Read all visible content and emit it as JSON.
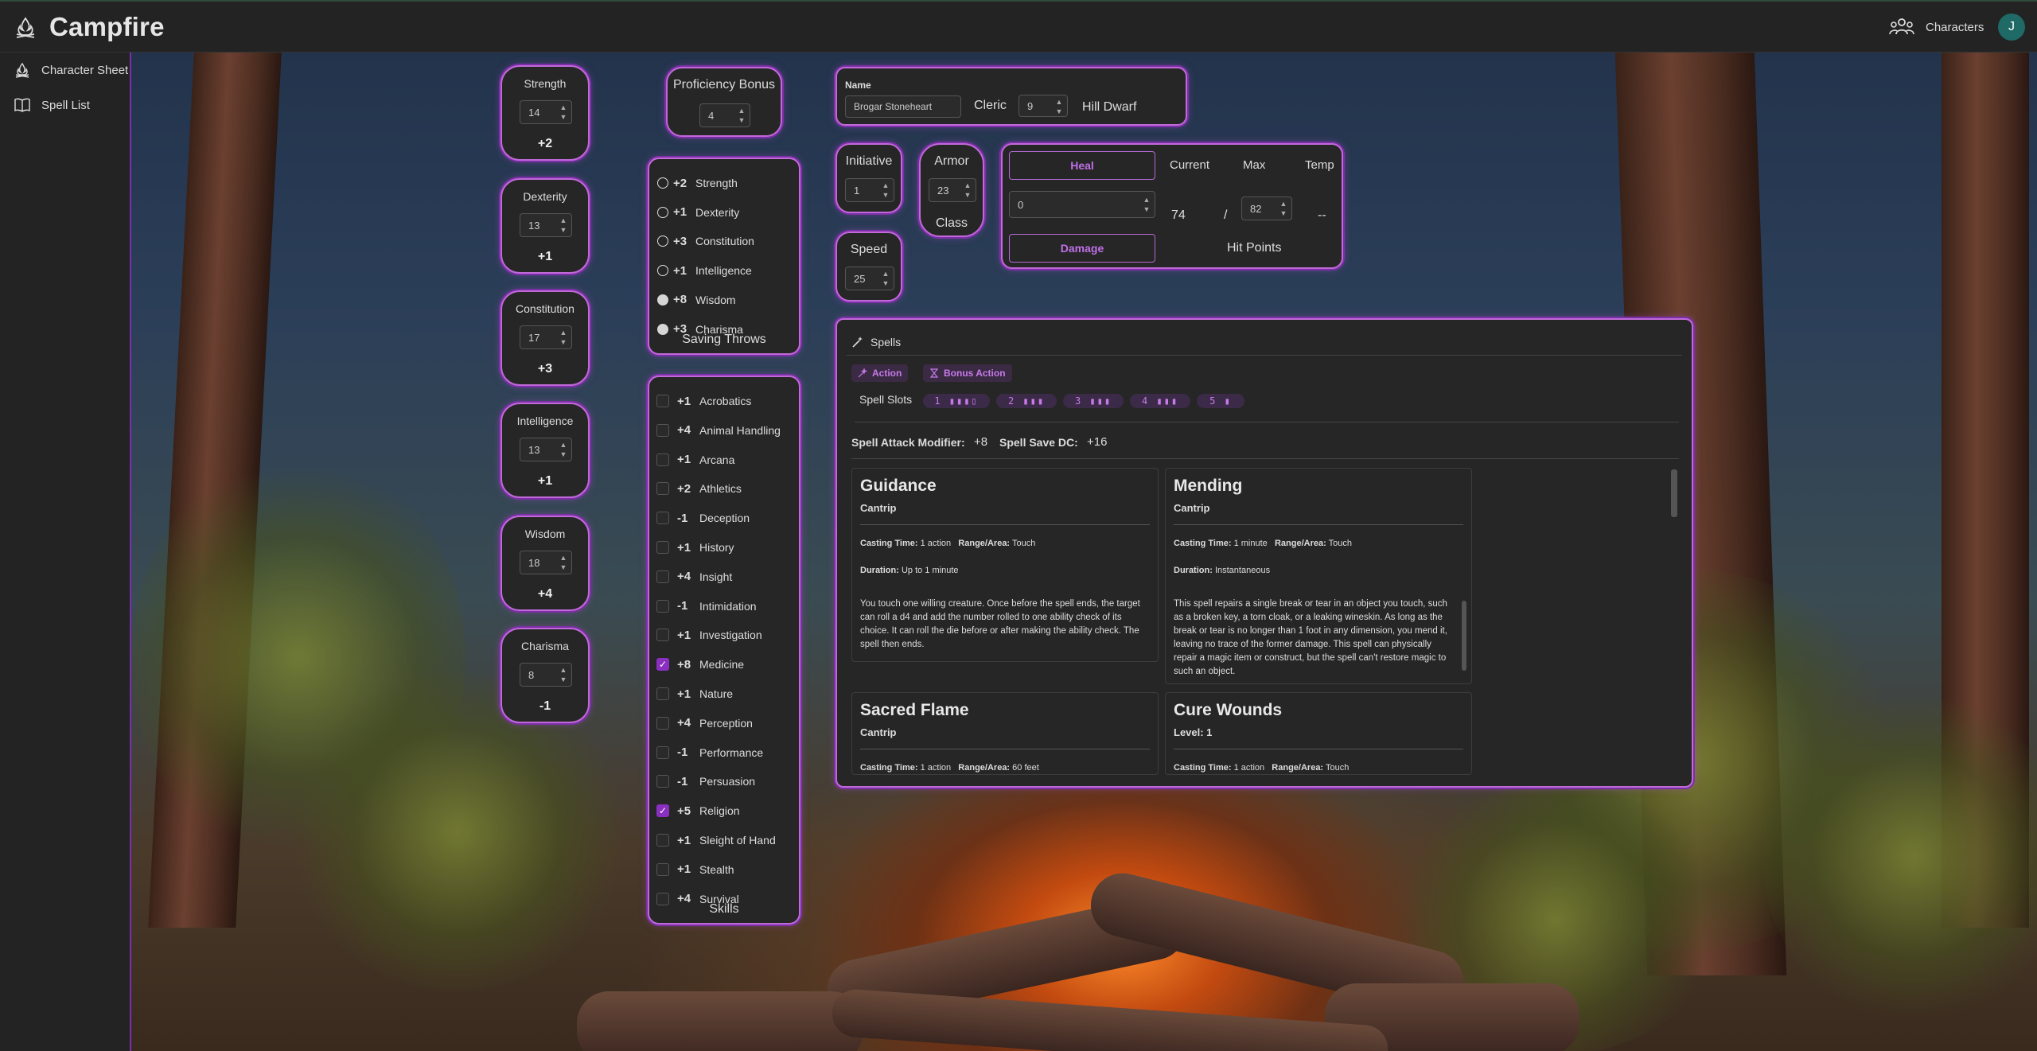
{
  "app": {
    "title": "Campfire",
    "characters_label": "Characters",
    "avatar_initial": "J"
  },
  "sidebar": {
    "items": [
      {
        "label": "Character Sheet",
        "icon": "campfire-icon"
      },
      {
        "label": "Spell List",
        "icon": "book-icon"
      }
    ]
  },
  "abilities": [
    {
      "name": "Strength",
      "score": "14",
      "mod": "+2"
    },
    {
      "name": "Dexterity",
      "score": "13",
      "mod": "+1"
    },
    {
      "name": "Constitution",
      "score": "17",
      "mod": "+3"
    },
    {
      "name": "Intelligence",
      "score": "13",
      "mod": "+1"
    },
    {
      "name": "Wisdom",
      "score": "18",
      "mod": "+4"
    },
    {
      "name": "Charisma",
      "score": "8",
      "mod": "-1"
    }
  ],
  "proficiency": {
    "label": "Proficiency Bonus",
    "value": "4"
  },
  "saving_throws": {
    "label": "Saving Throws",
    "items": [
      {
        "bonus": "+2",
        "name": "Strength",
        "proficient": false
      },
      {
        "bonus": "+1",
        "name": "Dexterity",
        "proficient": false
      },
      {
        "bonus": "+3",
        "name": "Constitution",
        "proficient": false
      },
      {
        "bonus": "+1",
        "name": "Intelligence",
        "proficient": false
      },
      {
        "bonus": "+8",
        "name": "Wisdom",
        "proficient": true
      },
      {
        "bonus": "+3",
        "name": "Charisma",
        "proficient": true
      }
    ]
  },
  "skills": {
    "label": "Skills",
    "items": [
      {
        "bonus": "+1",
        "name": "Acrobatics",
        "proficient": false
      },
      {
        "bonus": "+4",
        "name": "Animal Handling",
        "proficient": false
      },
      {
        "bonus": "+1",
        "name": "Arcana",
        "proficient": false
      },
      {
        "bonus": "+2",
        "name": "Athletics",
        "proficient": false
      },
      {
        "bonus": "-1",
        "name": "Deception",
        "proficient": false
      },
      {
        "bonus": "+1",
        "name": "History",
        "proficient": false
      },
      {
        "bonus": "+4",
        "name": "Insight",
        "proficient": false
      },
      {
        "bonus": "-1",
        "name": "Intimidation",
        "proficient": false
      },
      {
        "bonus": "+1",
        "name": "Investigation",
        "proficient": false
      },
      {
        "bonus": "+8",
        "name": "Medicine",
        "proficient": true
      },
      {
        "bonus": "+1",
        "name": "Nature",
        "proficient": false
      },
      {
        "bonus": "+4",
        "name": "Perception",
        "proficient": false
      },
      {
        "bonus": "-1",
        "name": "Performance",
        "proficient": false
      },
      {
        "bonus": "-1",
        "name": "Persuasion",
        "proficient": false
      },
      {
        "bonus": "+5",
        "name": "Religion",
        "proficient": true
      },
      {
        "bonus": "+1",
        "name": "Sleight of Hand",
        "proficient": false
      },
      {
        "bonus": "+1",
        "name": "Stealth",
        "proficient": false
      },
      {
        "bonus": "+4",
        "name": "Survival",
        "proficient": false
      }
    ]
  },
  "character": {
    "name_label": "Name",
    "name": "Brogar Stoneheart",
    "class": "Cleric",
    "level": "9",
    "race": "Hill Dwarf"
  },
  "initiative": {
    "label": "Initiative",
    "value": "1"
  },
  "armor": {
    "label_top": "Armor",
    "label_bottom": "Class",
    "value": "23"
  },
  "speed": {
    "label": "Speed",
    "value": "25"
  },
  "hp": {
    "heal_label": "Heal",
    "damage_label": "Damage",
    "amount": "0",
    "current_label": "Current",
    "max_label": "Max",
    "temp_label": "Temp",
    "current": "74",
    "separator": "/",
    "max": "82",
    "temp": "--",
    "title": "Hit Points"
  },
  "spells": {
    "tab_label": "Spells",
    "filters": [
      "Action",
      "Bonus Action"
    ],
    "slots_label": "Spell Slots",
    "slots": [
      "1 ▮▮▮▯",
      "2 ▮▮▮",
      "3 ▮▮▮",
      "4 ▮▮▮",
      "5 ▮"
    ],
    "attack_label": "Spell Attack Modifier:",
    "attack_value": "+8",
    "dc_label": "Spell Save DC:",
    "dc_value": "+16",
    "list": [
      {
        "name": "Guidance",
        "level": "Cantrip",
        "casting_time": "1 action",
        "range": "Touch",
        "duration": "Up to 1 minute",
        "description": "You touch one willing creature. Once before the spell ends, the target can roll a d4 and add the number rolled to one ability check of its choice. It can roll the die before or after making the ability check. The spell then ends."
      },
      {
        "name": "Mending",
        "level": "Cantrip",
        "casting_time": "1 minute",
        "range": "Touch",
        "duration": "Instantaneous",
        "description": "This spell repairs a single break or tear in an object you touch, such as a broken key, a torn cloak, or a leaking wineskin. As long as the break or tear is no longer than 1 foot in any dimension, you mend it, leaving no trace of the former damage. This spell can physically repair a magic item or construct, but the spell can't restore magic to such an object."
      },
      {
        "name": "Sacred Flame",
        "level": "Cantrip",
        "casting_time": "1 action",
        "range": "60 feet"
      },
      {
        "name": "Cure Wounds",
        "level": "Level: 1",
        "casting_time": "1 action",
        "range": "Touch"
      }
    ],
    "meta_labels": {
      "casting_time": "Casting Time:",
      "range": "Range/Area:",
      "duration": "Duration:"
    }
  },
  "colors": {
    "accent": "#c06ad8",
    "accent_dark": "#7d2fa8",
    "panel": "#262626",
    "avatar": "#1f6a66"
  }
}
